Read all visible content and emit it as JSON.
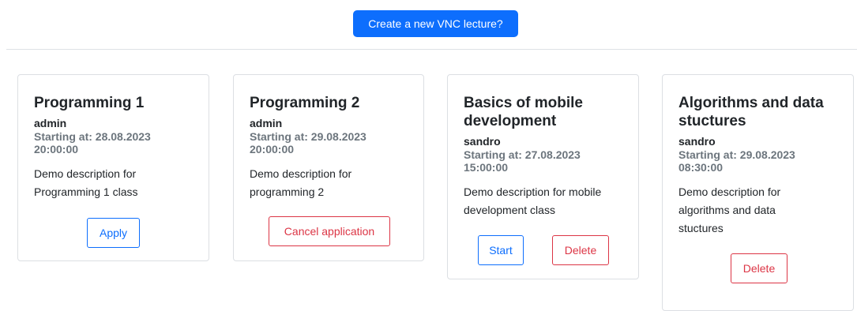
{
  "header": {
    "create_label": "Create a new VNC lecture?"
  },
  "colors": {
    "primary": "#0d6efd",
    "danger": "#dc3545",
    "muted": "#6c757d"
  },
  "cards": [
    {
      "title": "Programming 1",
      "author": "admin",
      "starting": "Starting at: 28.08.2023 20:00:00",
      "description": "Demo description for Programming 1 class",
      "buttons": [
        {
          "label": "Apply"
        }
      ]
    },
    {
      "title": "Programming 2",
      "author": "admin",
      "starting": "Starting at: 29.08.2023 20:00:00",
      "description": "Demo description for programming 2",
      "buttons": [
        {
          "label": "Cancel application"
        }
      ]
    },
    {
      "title": "Basics of mobile development",
      "author": "sandro",
      "starting": "Starting at: 27.08.2023 15:00:00",
      "description": "Demo description for mobile development class",
      "buttons": [
        {
          "label": "Start"
        },
        {
          "label": "Delete"
        }
      ]
    },
    {
      "title": "Algorithms and data stuctures",
      "author": "sandro",
      "starting": "Starting at: 29.08.2023 08:30:00",
      "description": "Demo description for algorithms and data stuctures",
      "buttons": [
        {
          "label": "Delete"
        }
      ]
    }
  ]
}
